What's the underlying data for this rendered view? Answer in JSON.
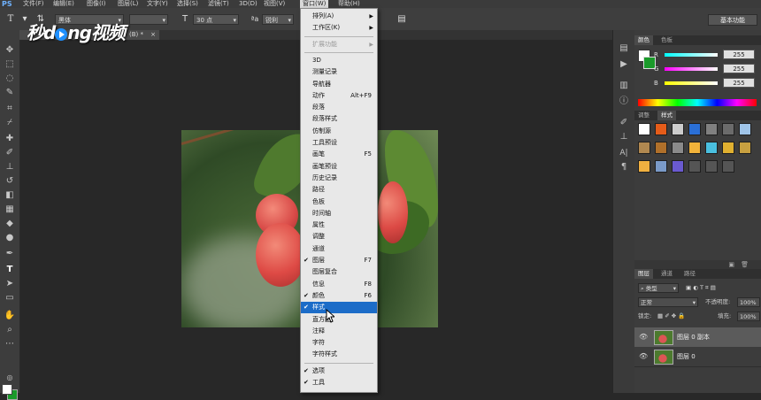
{
  "app": {
    "logo": "PS"
  },
  "menubar": {
    "items": [
      "文件(F)",
      "编辑(E)",
      "图像(I)",
      "图层(L)",
      "文字(Y)",
      "选择(S)",
      "滤镜(T)",
      "3D(D)",
      "视图(V)",
      "窗口(W)",
      "帮助(H)"
    ],
    "active": "窗口(W)"
  },
  "options_bar": {
    "tool_icon": "T",
    "font_family": "黑体",
    "font_size": "30 点",
    "antialias": "锐利",
    "workspace": "基本功能"
  },
  "document": {
    "tab_label": "(B) *"
  },
  "watermark": {
    "text_a": "秒d",
    "text_b": "ng视频"
  },
  "window_menu": {
    "items": [
      {
        "label": "排列(A)",
        "submenu": true
      },
      {
        "label": "工作区(K)",
        "submenu": true
      },
      {
        "separator": true
      },
      {
        "label": "扩展功能",
        "submenu": true,
        "disabled": true
      },
      {
        "separator": true
      },
      {
        "label": "3D"
      },
      {
        "label": "测量记录"
      },
      {
        "label": "导航器"
      },
      {
        "label": "动作",
        "shortcut": "Alt+F9"
      },
      {
        "label": "段落"
      },
      {
        "label": "段落样式"
      },
      {
        "label": "仿制源"
      },
      {
        "label": "工具预设"
      },
      {
        "label": "画笔",
        "shortcut": "F5"
      },
      {
        "label": "画笔预设"
      },
      {
        "label": "历史记录"
      },
      {
        "label": "路径"
      },
      {
        "label": "色板"
      },
      {
        "label": "时间轴"
      },
      {
        "label": "属性"
      },
      {
        "label": "调整"
      },
      {
        "label": "通道"
      },
      {
        "label": "图层",
        "shortcut": "F7",
        "checked": true
      },
      {
        "label": "图层复合"
      },
      {
        "label": "信息",
        "shortcut": "F8"
      },
      {
        "label": "颜色",
        "shortcut": "F6",
        "checked": true
      },
      {
        "label": "样式",
        "checked": true,
        "highlighted": true
      },
      {
        "label": "直方图"
      },
      {
        "label": "注释"
      },
      {
        "label": "字符"
      },
      {
        "label": "字符样式"
      },
      {
        "separator": true
      },
      {
        "label": "选项",
        "checked": true
      },
      {
        "label": "工具",
        "checked": true
      }
    ]
  },
  "color_panel": {
    "tabs": [
      "颜色",
      "色板"
    ],
    "channels": [
      {
        "name": "R",
        "value": "255"
      },
      {
        "name": "G",
        "value": "255"
      },
      {
        "name": "B",
        "value": "255"
      }
    ],
    "colors": {
      "foreground": "#ffffff",
      "background": "#1a9a2a"
    }
  },
  "styles_panel": {
    "tabs": [
      "调整",
      "样式"
    ],
    "swatches": [
      "#ffffff",
      "#e65c19",
      "#cccccc",
      "#2a6fd6",
      "#808080",
      "#6b6b6b",
      "#9fc4e8",
      "#b08850",
      "#b0702a",
      "#8a8a8a",
      "#f2b33a",
      "#4ac0e0",
      "#e0b030",
      "#c8a040",
      "#f0b040",
      "#7a9ac8",
      "#6a5ad0",
      "#555555",
      "#555555",
      "#555555"
    ]
  },
  "layers_panel": {
    "tabs": [
      "图层",
      "通道",
      "路径"
    ],
    "kind_filter": "类型",
    "blend_mode": "正常",
    "opacity_label": "不透明度:",
    "opacity": "100%",
    "lock_label": "锁定:",
    "fill_label": "填充:",
    "fill": "100%",
    "layers": [
      {
        "name": "图层 0 副本",
        "selected": true
      },
      {
        "name": "图层 0",
        "selected": false
      }
    ]
  }
}
